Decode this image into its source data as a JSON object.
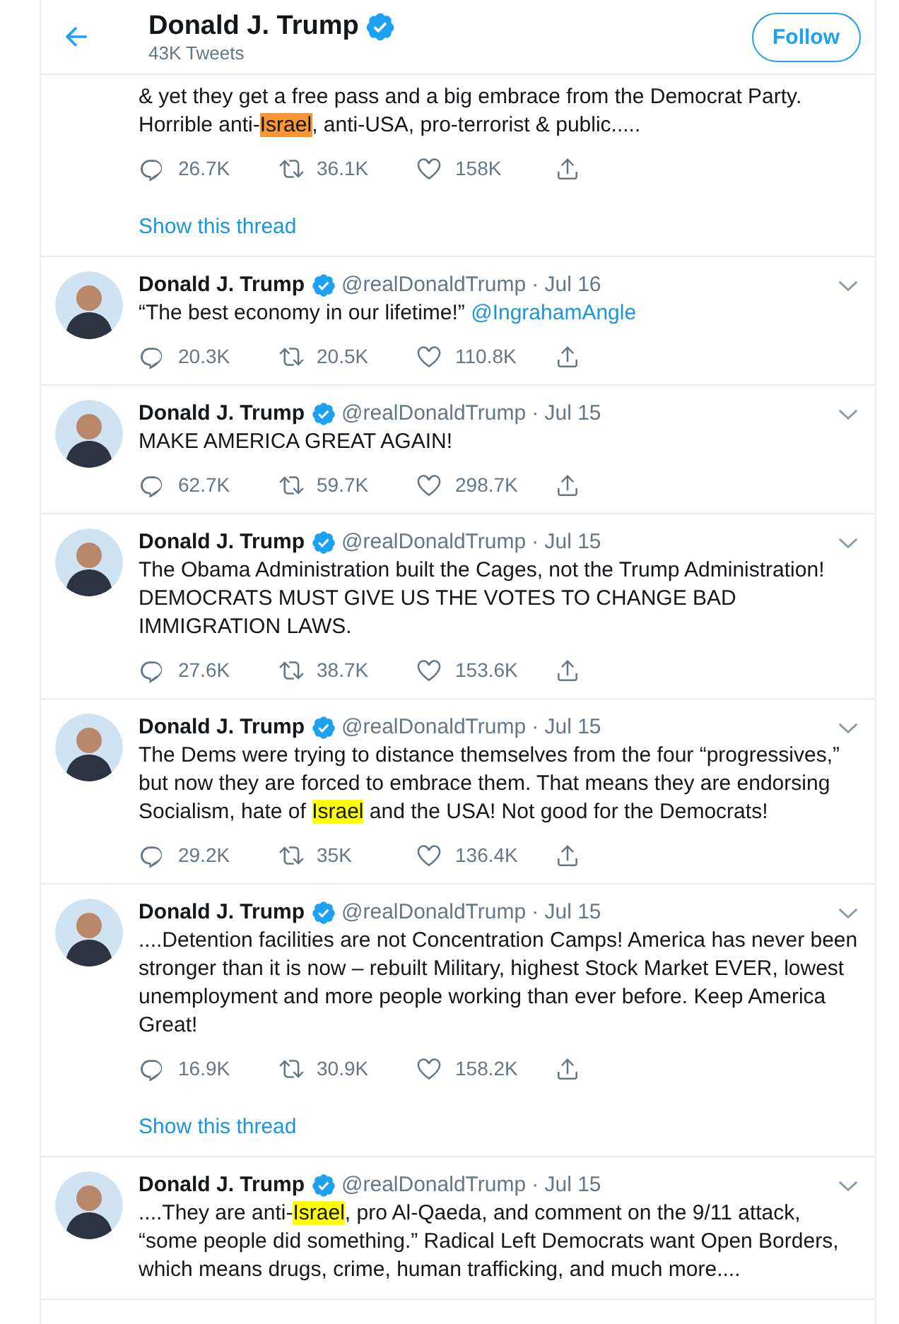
{
  "header": {
    "name": "Donald J. Trump",
    "verified": true,
    "tweet_count": "43K Tweets",
    "follow_button": "Follow"
  },
  "tweets": [
    {
      "segments": [
        {
          "kind": "text",
          "text": "& yet they get a free pass and a big embrace from the Democrat Party. Horrible anti-"
        },
        {
          "kind": "highlight",
          "text": "Israel",
          "color": "#f79632"
        },
        {
          "kind": "text",
          "text": ", anti-USA, pro-terrorist & public....."
        }
      ],
      "stats": {
        "replies": "26.7K",
        "retweets": "36.1K",
        "likes": "158K"
      },
      "show_thread": "Show this thread"
    },
    {
      "name": "Donald J. Trump",
      "verified": true,
      "handle": "@realDonaldTrump",
      "date": "· Jul 16",
      "segments": [
        {
          "kind": "text",
          "text": "“The best economy in our lifetime!” "
        },
        {
          "kind": "mention",
          "text": "@IngrahamAngle"
        }
      ],
      "stats": {
        "replies": "20.3K",
        "retweets": "20.5K",
        "likes": "110.8K"
      }
    },
    {
      "name": "Donald J. Trump",
      "verified": true,
      "handle": "@realDonaldTrump",
      "date": "· Jul 15",
      "segments": [
        {
          "kind": "text",
          "text": "MAKE AMERICA GREAT AGAIN!"
        }
      ],
      "stats": {
        "replies": "62.7K",
        "retweets": "59.7K",
        "likes": "298.7K"
      }
    },
    {
      "name": "Donald J. Trump",
      "verified": true,
      "handle": "@realDonaldTrump",
      "date": "· Jul 15",
      "segments": [
        {
          "kind": "text",
          "text": "The Obama Administration built the Cages, not the Trump Administration! DEMOCRATS MUST GIVE US THE VOTES TO CHANGE BAD IMMIGRATION LAWS."
        }
      ],
      "stats": {
        "replies": "27.6K",
        "retweets": "38.7K",
        "likes": "153.6K"
      }
    },
    {
      "name": "Donald J. Trump",
      "verified": true,
      "handle": "@realDonaldTrump",
      "date": "· Jul 15",
      "segments": [
        {
          "kind": "text",
          "text": "The Dems were trying to distance themselves from the four “progressives,” but now they are forced to embrace them. That means they are endorsing Socialism, hate of "
        },
        {
          "kind": "highlight",
          "text": "Israel",
          "color": "#ffff00"
        },
        {
          "kind": "text",
          "text": " and the USA! Not good for the Democrats!"
        }
      ],
      "stats": {
        "replies": "29.2K",
        "retweets": "35K",
        "likes": "136.4K"
      }
    },
    {
      "name": "Donald J. Trump",
      "verified": true,
      "handle": "@realDonaldTrump",
      "date": "· Jul 15",
      "segments": [
        {
          "kind": "text",
          "text": "....Detention facilities are not Concentration Camps! America has never been stronger than it is now – rebuilt Military, highest Stock Market EVER, lowest unemployment and more people working than ever before. Keep America Great!"
        }
      ],
      "stats": {
        "replies": "16.9K",
        "retweets": "30.9K",
        "likes": "158.2K"
      },
      "show_thread": "Show this thread"
    },
    {
      "name": "Donald J. Trump",
      "verified": true,
      "handle": "@realDonaldTrump",
      "date": "· Jul 15",
      "segments": [
        {
          "kind": "text",
          "text": "....They are anti-"
        },
        {
          "kind": "highlight",
          "text": "Israel",
          "color": "#ffff00"
        },
        {
          "kind": "text",
          "text": ", pro Al-Qaeda, and comment on the 9/11 attack, “some people did something.” Radical Left Democrats want Open Borders, which means drugs, crime, human trafficking, and much more...."
        }
      ]
    }
  ]
}
